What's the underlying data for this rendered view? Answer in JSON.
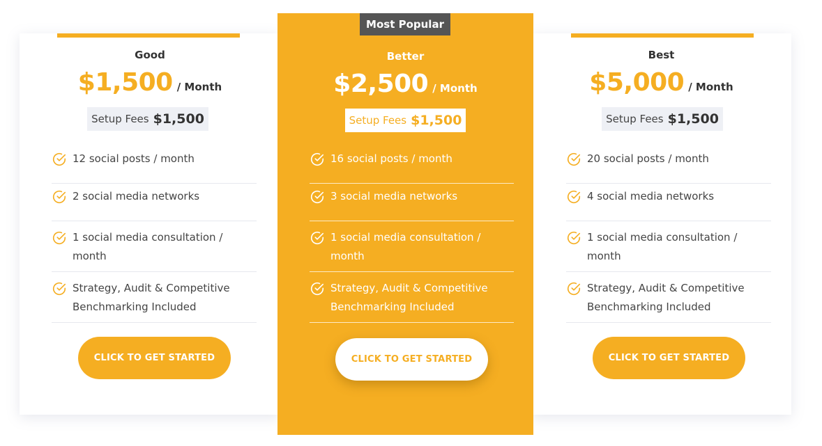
{
  "colors": {
    "accent": "#f5ae22",
    "badge": "#555555",
    "text": "#333333",
    "setup_bg": "#eef0f5"
  },
  "plans": [
    {
      "tier": "Good",
      "price": "$1,500",
      "period": "/ Month",
      "setup_label": "Setup Fees",
      "setup_amount": "$1,500",
      "features": [
        "12 social posts / month",
        "2 social media networks",
        "1 social media consultation / month",
        "Strategy, Audit & Competitive Benchmarking Included"
      ],
      "cta": "CLICK TO GET STARTED"
    },
    {
      "badge": "Most Popular",
      "tier": "Better",
      "price": "$2,500",
      "period": "/ Month",
      "setup_label": "Setup Fees",
      "setup_amount": "$1,500",
      "features": [
        "16 social posts / month",
        "3 social media networks",
        "1 social media consultation / month",
        "Strategy, Audit & Competitive Benchmarking Included"
      ],
      "cta": "CLICK TO GET STARTED"
    },
    {
      "tier": "Best",
      "price": "$5,000",
      "period": "/ Month",
      "setup_label": "Setup Fees",
      "setup_amount": "$1,500",
      "features": [
        "20 social posts / month",
        "4 social media networks",
        "1 social media consultation / month",
        "Strategy, Audit & Competitive Benchmarking Included"
      ],
      "cta": "CLICK TO GET STARTED"
    }
  ],
  "icons": {
    "feature": "check-circle-icon"
  }
}
